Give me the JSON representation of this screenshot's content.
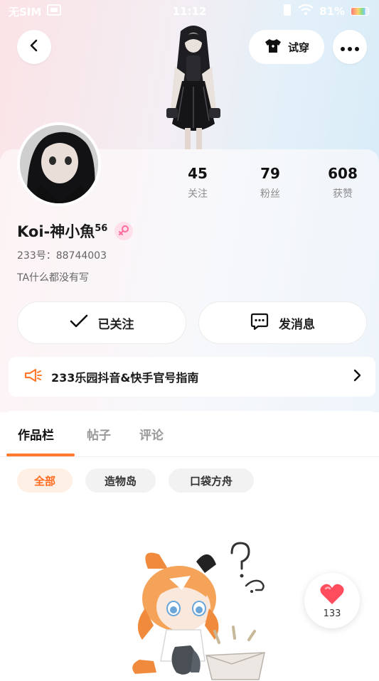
{
  "status_bar": {
    "carrier": "无SIM",
    "time": "11:12",
    "battery": "81%"
  },
  "header": {
    "try_on_label": "试穿"
  },
  "stats": [
    {
      "value": "45",
      "label": "关注"
    },
    {
      "value": "79",
      "label": "粉丝"
    },
    {
      "value": "608",
      "label": "获赞"
    }
  ],
  "profile": {
    "nickname": "Koi-神小魚",
    "level": "56",
    "uid": "233号：88744003",
    "bio": "TA什么都没有写"
  },
  "actions": {
    "followed_label": "已关注",
    "message_label": "发消息"
  },
  "notice": {
    "text": "233乐园抖音&快手官号指南"
  },
  "tabs": [
    {
      "label": "作品栏"
    },
    {
      "label": "帖子"
    },
    {
      "label": "评论"
    }
  ],
  "filters": [
    {
      "label": "全部"
    },
    {
      "label": "造物岛"
    },
    {
      "label": "口袋方舟"
    }
  ],
  "like": {
    "count": "133"
  },
  "colors": {
    "accent": "#ff7a2e",
    "heart": "#ff4d5e",
    "gender": "#ff6b9a"
  },
  "icons": [
    "back-icon",
    "shirt-icon",
    "more-icon",
    "check-icon",
    "chat-icon",
    "megaphone-icon",
    "chevron-right-icon",
    "heart-icon",
    "female-icon",
    "wifi-icon",
    "sim-icon",
    "battery-icon"
  ]
}
